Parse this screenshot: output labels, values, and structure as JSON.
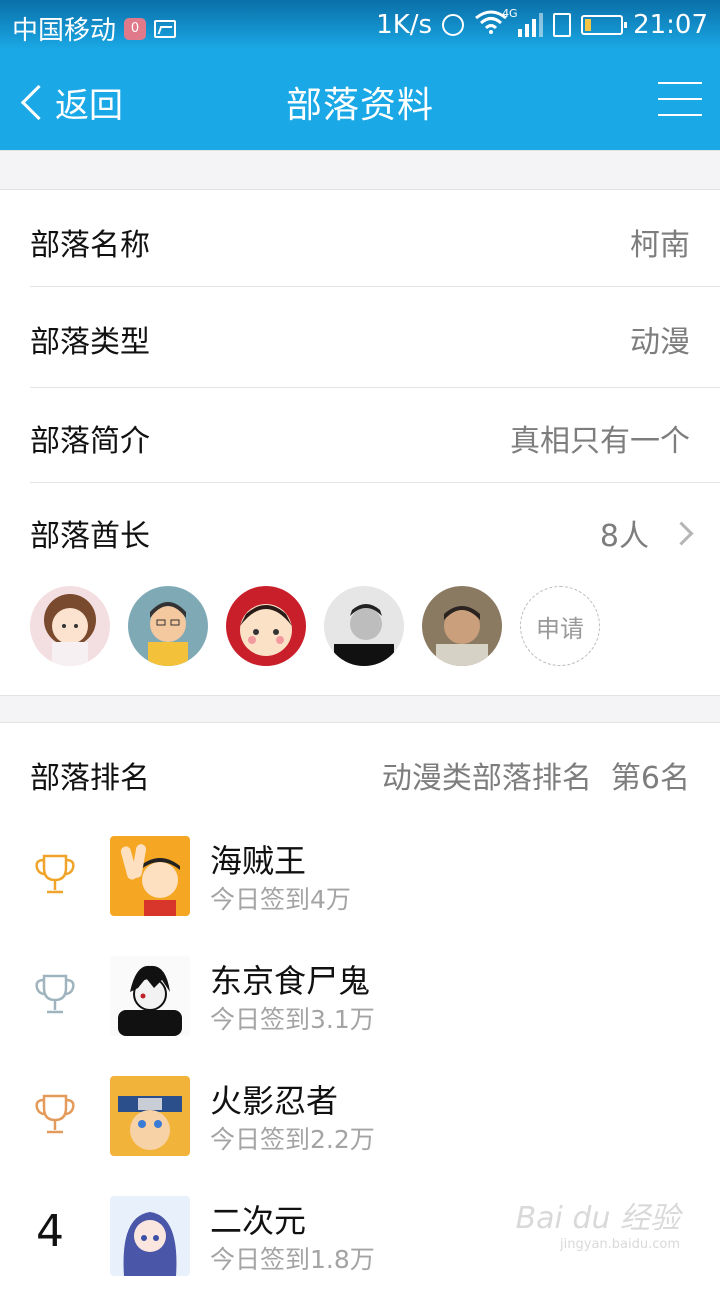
{
  "status_bar": {
    "carrier": "中国移动",
    "badge": "0",
    "speed": "1K/s",
    "network": "4G",
    "time": "21:07"
  },
  "nav": {
    "back_label": "返回",
    "title": "部落资料"
  },
  "info": {
    "name_label": "部落名称",
    "name_value": "柯南",
    "type_label": "部落类型",
    "type_value": "动漫",
    "intro_label": "部落简介",
    "intro_value": "真相只有一个",
    "chiefs_label": "部落酋长",
    "chiefs_count": "8人",
    "apply_label": "申请"
  },
  "ranking": {
    "label": "部落排名",
    "category_rank": "动漫类部落排名",
    "position": "第6名",
    "items": [
      {
        "rank": "1",
        "name": "海贼王",
        "sub": "今日签到4万",
        "trophy_color": "#f0a52a"
      },
      {
        "rank": "2",
        "name": "东京食尸鬼",
        "sub": "今日签到3.1万",
        "trophy_color": "#9fb4be"
      },
      {
        "rank": "3",
        "name": "火影忍者",
        "sub": "今日签到2.2万",
        "trophy_color": "#e39a5a"
      },
      {
        "rank": "4",
        "name": "二次元",
        "sub": "今日签到1.8万"
      }
    ]
  },
  "watermark": {
    "brand": "Bai du 经验",
    "url": "jingyan.baidu.com"
  }
}
